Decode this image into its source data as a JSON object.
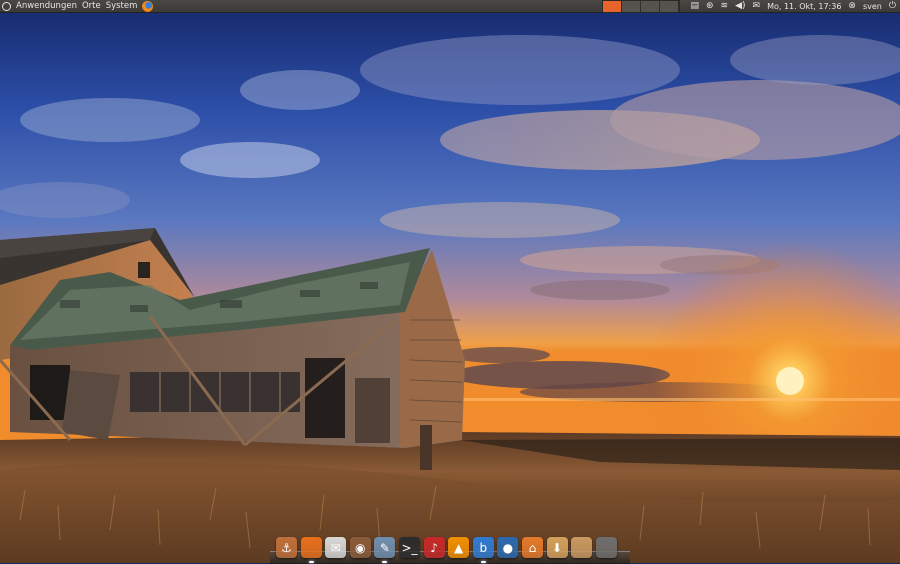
{
  "top_panel": {
    "menus": [
      "Anwendungen",
      "Orte",
      "System"
    ],
    "workspace_count": 4,
    "active_workspace": 1,
    "tray_icons": [
      "notes-icon",
      "network-antenna-icon",
      "wifi-icon",
      "volume-icon",
      "mail-icon"
    ],
    "clock": "Mo, 11. Okt, 17:36",
    "user": "sven"
  },
  "dock": {
    "items": [
      {
        "name": "anchor-icon",
        "glyph": "⚓",
        "color": "#c0703a",
        "active": false
      },
      {
        "name": "firefox-icon",
        "glyph": "",
        "color": "#e8701c",
        "active": true
      },
      {
        "name": "mail-client-icon",
        "glyph": "✉",
        "color": "#d8d8d8",
        "active": false
      },
      {
        "name": "network-monitor-icon",
        "glyph": "◉",
        "color": "#8a5c3a",
        "active": false
      },
      {
        "name": "text-editor-icon",
        "glyph": "✎",
        "color": "#6f8fb0",
        "active": true
      },
      {
        "name": "terminal-icon",
        "glyph": ">_",
        "color": "#2b2b2b",
        "active": false
      },
      {
        "name": "music-player-icon",
        "glyph": "♪",
        "color": "#c62828",
        "active": false
      },
      {
        "name": "vlc-icon",
        "glyph": "▲",
        "color": "#f29000",
        "active": false
      },
      {
        "name": "web-browser-icon",
        "glyph": "b",
        "color": "#2f7bd3",
        "active": true
      },
      {
        "name": "chat-icon",
        "glyph": "●",
        "color": "#2a69b0",
        "active": false
      },
      {
        "name": "home-folder-icon",
        "glyph": "⌂",
        "color": "#e57a2a",
        "active": false
      },
      {
        "name": "downloads-folder-icon",
        "glyph": "⬇",
        "color": "#d4a15c",
        "active": false
      },
      {
        "name": "folder-icon",
        "glyph": "",
        "color": "#c89960",
        "active": false
      },
      {
        "name": "trash-icon",
        "glyph": "",
        "color": "#6e6e6e",
        "active": false
      }
    ]
  }
}
